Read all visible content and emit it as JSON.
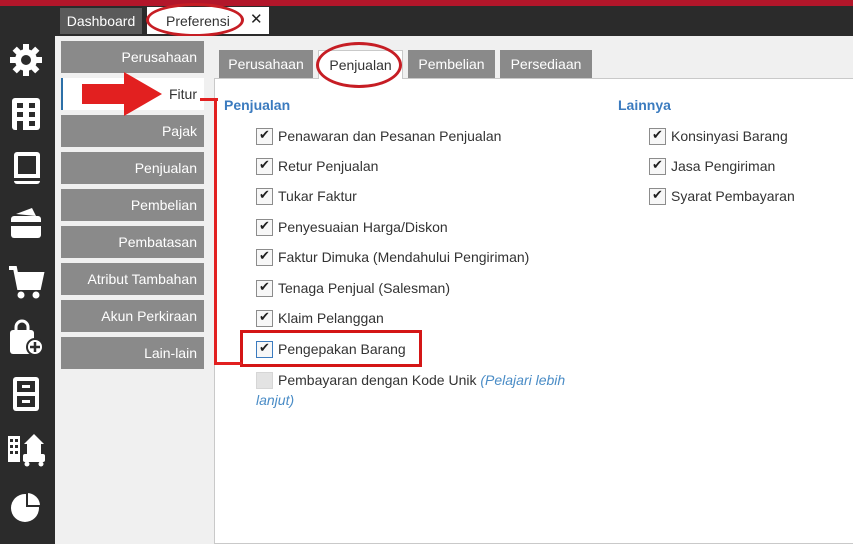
{
  "tabs": {
    "dashboard": "Dashboard",
    "preferensi": "Preferensi",
    "close_symbol": "✕"
  },
  "sidebar_icons": [
    "gear-icon",
    "building-icon",
    "book-icon",
    "wallet-icon",
    "cart-icon",
    "bag-add-icon",
    "cabinet-icon",
    "store-icon",
    "pie-chart-icon"
  ],
  "sidenav": [
    "Perusahaan",
    "Fitur",
    "Pajak",
    "Penjualan",
    "Pembelian",
    "Pembatasan",
    "Atribut Tambahan",
    "Akun Perkiraan",
    "Lain-lain"
  ],
  "subtabs": [
    "Perusahaan",
    "Penjualan",
    "Pembelian",
    "Persediaan"
  ],
  "sections": {
    "penjualan_title": "Penjualan",
    "lainnya_title": "Lainnya"
  },
  "penjualan_options": [
    {
      "label": "Penawaran dan Pesanan Penjualan",
      "checked": true
    },
    {
      "label": "Retur Penjualan",
      "checked": true
    },
    {
      "label": "Tukar Faktur",
      "checked": true
    },
    {
      "label": "Penyesuaian Harga/Diskon",
      "checked": true
    },
    {
      "label": "Faktur Dimuka (Mendahului Pengiriman)",
      "checked": true
    },
    {
      "label": "Tenaga Penjual (Salesman)",
      "checked": true
    },
    {
      "label": "Klaim Pelanggan",
      "checked": true
    },
    {
      "label": "Pengepakan Barang",
      "checked": true
    }
  ],
  "unique_code_option": {
    "label": "Pembayaran dengan Kode Unik",
    "link_line1": "(Pelajari lebih",
    "link_line2": "lanjut)",
    "checked": false
  },
  "lainnya_options": [
    {
      "label": "Konsinyasi Barang",
      "checked": true
    },
    {
      "label": "Jasa Pengiriman",
      "checked": true
    },
    {
      "label": "Syarat Pembayaran",
      "checked": true
    }
  ],
  "colors": {
    "accent_red": "#d41616",
    "section_blue": "#3b7bbf",
    "sidebar_dark": "#2b2b2b",
    "nav_gray": "#8a8a8a"
  }
}
